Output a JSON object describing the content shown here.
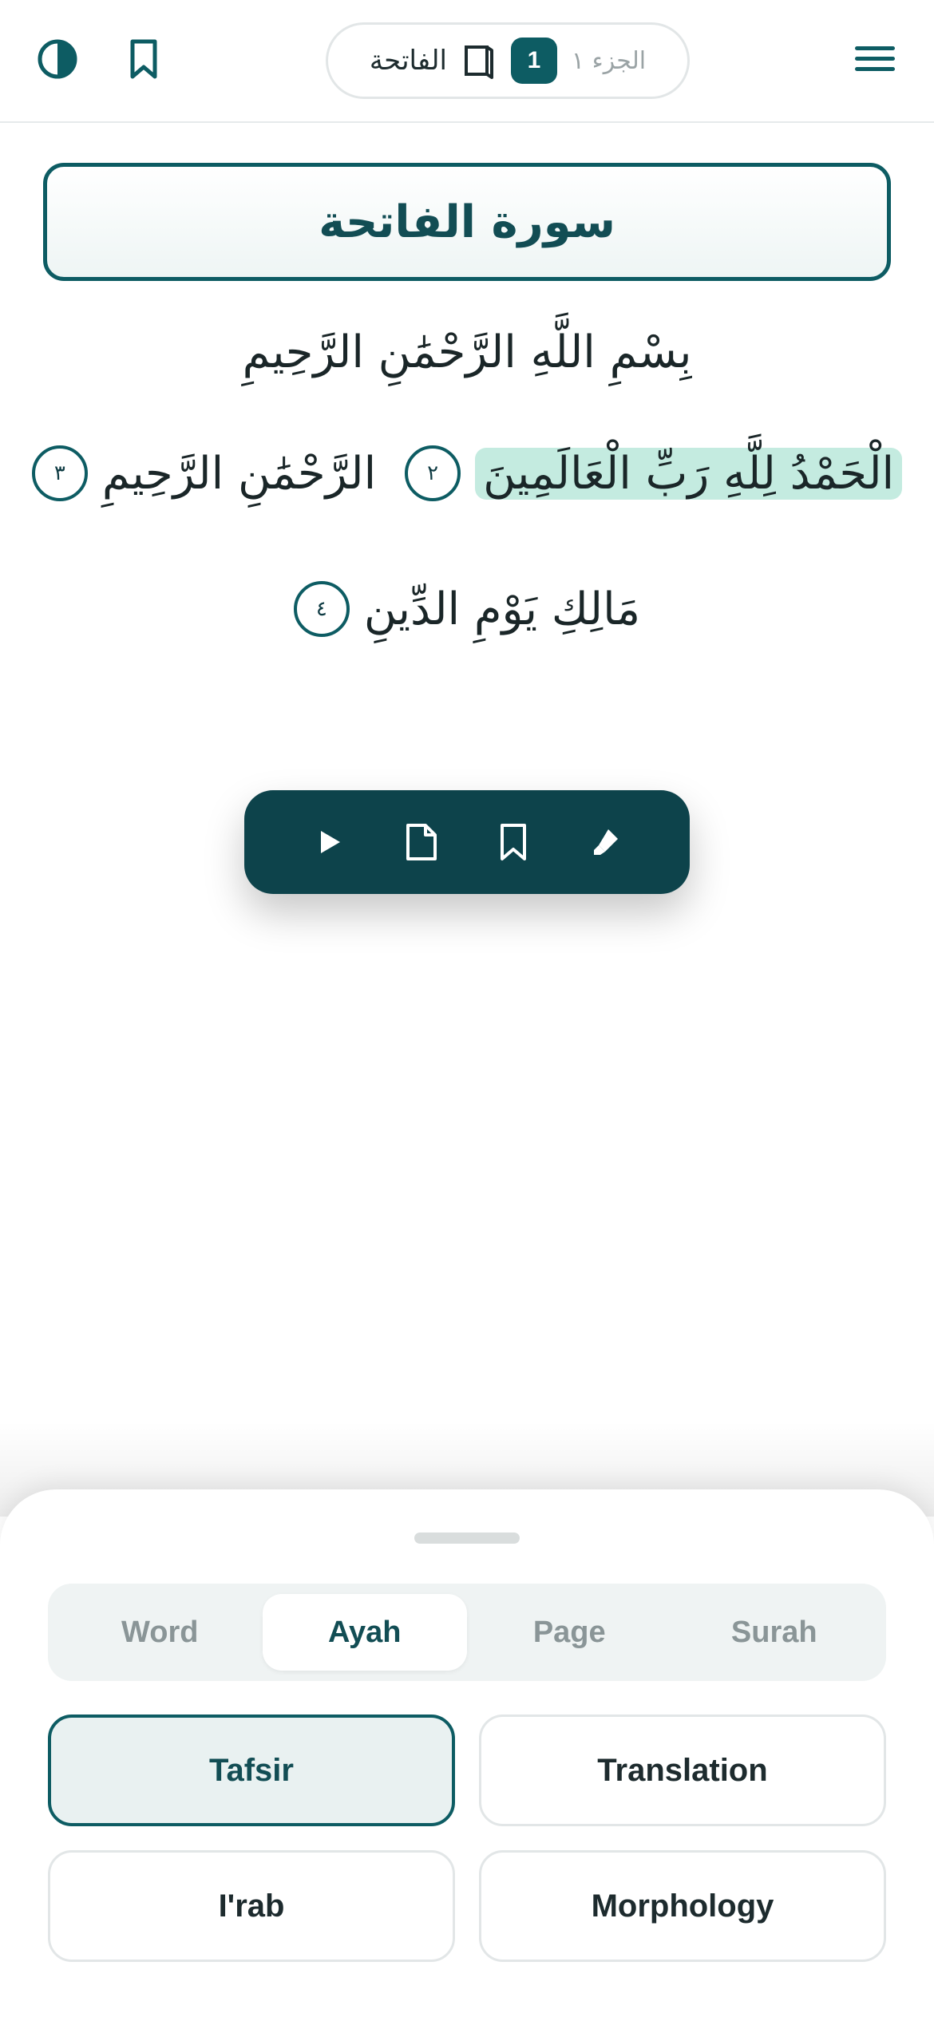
{
  "header": {
    "surah_name": "الفاتحة",
    "page_number": "1",
    "juz_label": "الجزء ١",
    "icons": [
      "theme-toggle-icon",
      "bookmark-icon",
      "book-icon",
      "menu-icon"
    ]
  },
  "surah_title": "سورة الفاتحة",
  "basmala": "بِسْمِ اللَّهِ الرَّحْمَٰنِ الرَّحِيمِ",
  "ayahs": [
    {
      "text": "الْحَمْدُ لِلَّهِ رَبِّ الْعَالَمِينَ",
      "number": "٢",
      "highlighted": true
    },
    {
      "text": "الرَّحْمَٰنِ الرَّحِيمِ",
      "number": "٣",
      "highlighted": false
    },
    {
      "text": "مَالِكِ يَوْمِ الدِّينِ",
      "number": "٤",
      "highlighted": false
    }
  ],
  "toolbar": {
    "icons": [
      "play-icon",
      "document-icon",
      "bookmark-icon",
      "highlighter-icon"
    ]
  },
  "sheet": {
    "tabs": [
      {
        "label": "Word",
        "active": false
      },
      {
        "label": "Ayah",
        "active": true
      },
      {
        "label": "Page",
        "active": false
      },
      {
        "label": "Surah",
        "active": false
      }
    ],
    "options": [
      {
        "label": "Tafsir",
        "active": true
      },
      {
        "label": "Translation",
        "active": false
      },
      {
        "label": "I'rab",
        "active": false
      },
      {
        "label": "Morphology",
        "active": false
      }
    ]
  },
  "colors": {
    "primary": "#0d5c63",
    "toolbar": "#0d434b",
    "highlight": "#c4ebe0",
    "muted": "#8a9597"
  }
}
